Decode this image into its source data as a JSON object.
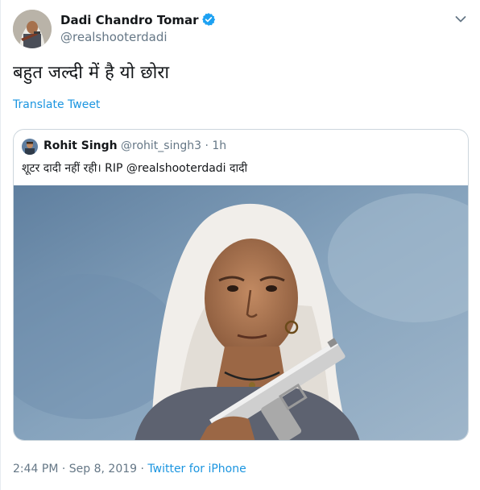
{
  "author": {
    "name": "Dadi Chandro Tomar",
    "handle": "@realshooterdadi",
    "avatar_icon": "profile-photo",
    "verified_icon": "verified-badge-icon"
  },
  "tweet": {
    "text": "बहुत जल्दी में है यो छोरा",
    "translate_label": "Translate Tweet"
  },
  "quoted": {
    "name": "Rohit Singh",
    "handle": "@rohit_singh3",
    "separator": "·",
    "time": "1h",
    "text": "शूटर दादी नहीं रही। RIP @realshooterdadi दादी",
    "photo_icon": "photo-elderly-woman-with-pistol"
  },
  "footer": {
    "timestamp": "2:44 PM · Sep 8, 2019 ·",
    "source": "Twitter for iPhone"
  },
  "colors": {
    "link": "#1b95e0",
    "verified": "#1da1f2",
    "secondary_text": "#657786",
    "border": "#ccd6dd"
  }
}
